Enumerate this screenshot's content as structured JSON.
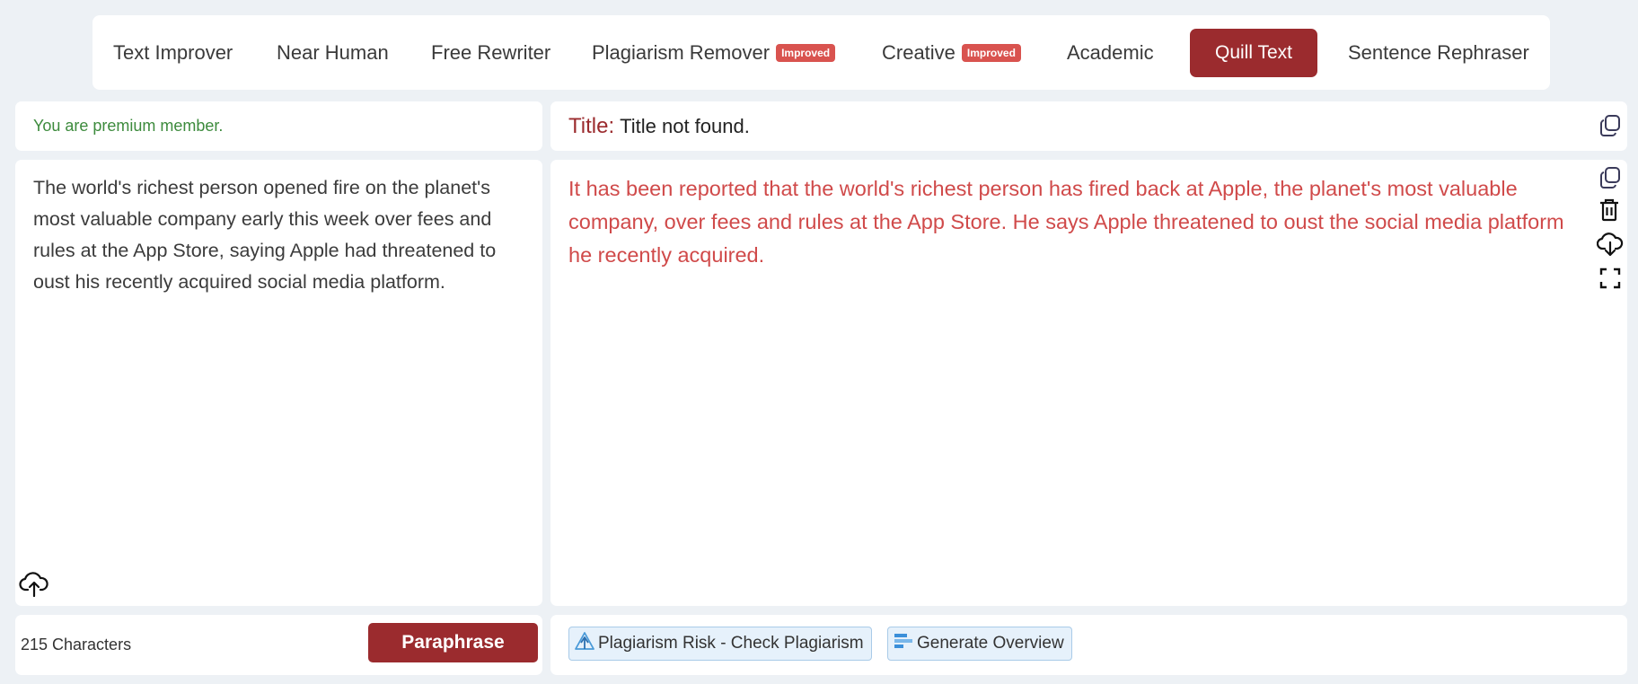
{
  "modes": [
    {
      "label": "Text Improver"
    },
    {
      "label": "Near Human"
    },
    {
      "label": "Free Rewriter"
    },
    {
      "label": "Plagiarism Remover",
      "badge": "Improved"
    },
    {
      "label": "Creative",
      "badge": "Improved"
    },
    {
      "label": "Academic"
    },
    {
      "label": "Quill Text",
      "active": true
    },
    {
      "label": "Sentence Rephraser"
    }
  ],
  "member_status": "You are premium member.",
  "title": {
    "label": "Title:",
    "text": "Title not found."
  },
  "input_text": "The world's richest person opened fire on the planet's most valuable company early this week over fees and rules at the App Store, saying Apple had threatened to oust his recently acquired social media platform.",
  "output_text": "It has been reported that the world's richest person has fired back at Apple, the planet's most valuable company, over fees and rules at the App Store. He says Apple threatened to oust the social media platform he recently acquired.",
  "char_count": "215 Characters",
  "paraphrase_label": "Paraphrase",
  "plagiarism_label": "Plagiarism Risk - Check Plagiarism",
  "overview_label": "Generate Overview",
  "icons": [
    "copy-icon",
    "trash-icon",
    "cloud-download-icon",
    "fullscreen-icon",
    "cloud-upload-icon",
    "warning-icon",
    "overview-bars-icon"
  ],
  "colors": {
    "accent": "#9b2b2e",
    "badge": "#d9534f",
    "output_text": "#d04a4a",
    "member": "#3d8b3d"
  }
}
